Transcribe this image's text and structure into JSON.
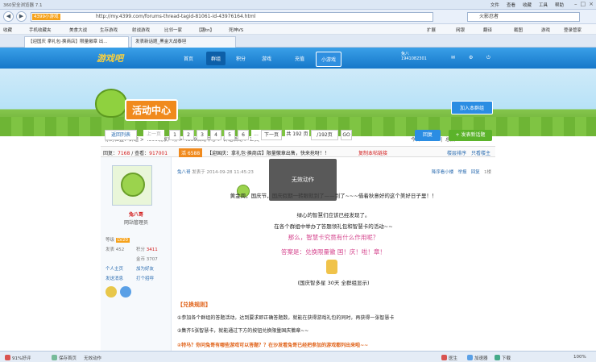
{
  "browser": {
    "title": "360安全浏览器 7.1",
    "menu": [
      "文件",
      "查看",
      "收藏",
      "工具",
      "帮助"
    ],
    "url_tag": "4399小游戏",
    "url": "http://my.4399.com/forums-thread-tagid-81061-id-43976164.html",
    "search": "火影忍者",
    "favorites": [
      "收藏",
      "手机收藏夹",
      "美食大战",
      "生存游戏",
      "射战游戏",
      "比邻一家",
      "【趣tn】",
      "死神VS"
    ],
    "fav_right": [
      "扩展",
      "网银",
      "翻译",
      "截图",
      "游戏",
      "登录管家"
    ],
    "tabs": [
      "【迎国庆 拿礼包·换商店】限量徽章 出...",
      "发表新话题_黑金大战泰坦"
    ]
  },
  "site": {
    "logo": "游戏吧",
    "nav": [
      "首页",
      "群组",
      "积分",
      "游戏",
      "充值",
      "小游戏"
    ],
    "nav_active": "群组",
    "user": {
      "name": "兔八",
      "id": "1941082301"
    }
  },
  "banner": {
    "title": "活动中心",
    "join": "加入本群组"
  },
  "crumb": "你的位置：群组 > 4399玩家广场 > 4399活动中心 > 群组活动 > 正文",
  "stats": {
    "label_today": "今日：",
    "today": "1984",
    "label_total": "总数：",
    "total": "6243"
  },
  "pager": {
    "back": "返回列表",
    "prev": "上一页",
    "pages": [
      "1",
      "2",
      "3",
      "4",
      "5",
      "6"
    ],
    "ellipsis": "...",
    "next": "下一页",
    "total": "共 192 页",
    "input": "/192页",
    "go": "GO"
  },
  "actions": {
    "reply": "回复",
    "new_topic": "+ 发表新话题"
  },
  "thread": {
    "reply_label": "回复：",
    "replies": "7168",
    "view_label": "查看：",
    "views": "917001",
    "tag": "活 6588",
    "title": "【迎国庆：拿礼包·换商店】限量徽章出售，快来抢呀！！",
    "extra": "复制本帖链接",
    "sort": "楼层排序",
    "lz": "只看楼主"
  },
  "author": {
    "name": "兔八哥",
    "role": "网站管理员",
    "stats": [
      [
        "等级",
        "LV20"
      ],
      [
        "发表",
        "452"
      ],
      [
        "积分",
        "3411"
      ],
      [
        "金币",
        "3707"
      ]
    ],
    "links": [
      "个人主页",
      "加为好友",
      "发送消息",
      "打个招呼"
    ]
  },
  "post": {
    "author": "兔八哥",
    "time": "发表于 2014-09-28 11:45:23",
    "right": [
      "降序看小楼",
      "举报",
      "回复",
      "1楼"
    ],
    "lines": [
      "黄金周，国庆节，国庆假期一转眼就到了——到了~~~借着秋意好的这个美好日子里！！",
      "绿心的智慧们应该已经发现了。",
      "在各个群组中举办了答题领礼包和智慧卡的活动~~",
      "那么，智慧卡究竟有什么作用呢？",
      "答案是：兑换限量徽 国！庆！啦！章！",
      "(国庆智多星 30天 全群组显示)"
    ],
    "section": "【兑换规则】",
    "rules": [
      "①参加各个群组的答题活动，达到要求即正确答题数，就能在获得游戏礼包的同时，再获得一张智慧卡",
      "②集齐5张智慧卡，就能通过下方的按钮兑换限量国庆徽章~~"
    ],
    "qa": "②特马？你问兔哥有哪些游戏可以答题？？在沙发看兔哥已经把参加的游戏都列出来啦~~"
  },
  "overlay": "无效动作",
  "statusbar": [
    "91%好评",
    "保存首页",
    "无效动作",
    "医生",
    "加速器",
    "下载",
    "100%"
  ]
}
